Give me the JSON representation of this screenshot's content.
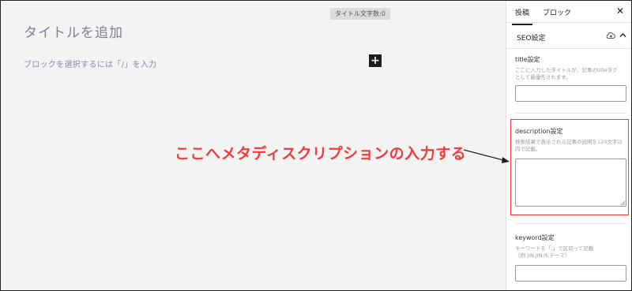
{
  "editor": {
    "title_count_badge": "タイトル文字数:0",
    "title_placeholder": "タイトルを追加",
    "block_prompt": "ブロックを選択するには「/」を入力",
    "add_block_symbol": "+"
  },
  "annotation": {
    "text": "ここへメタディスクリプションの入力する",
    "color": "#f23a3a"
  },
  "sidebar": {
    "tabs": [
      {
        "label": "投稿",
        "active": true
      },
      {
        "label": "ブロック",
        "active": false
      }
    ],
    "close_symbol": "✕",
    "panel": {
      "title": "SEO設定",
      "icons": [
        "cloud-icon",
        "chevron-up-icon"
      ]
    },
    "fields": [
      {
        "label": "title設定",
        "help": "ここに入力したタイトルが、記事のtitleタグとして最優先されます。",
        "value": ""
      },
      {
        "label": "description設定",
        "help": "検索結果で表示される記事の説明を120文字以内で記載。",
        "value": "",
        "highlighted": true
      },
      {
        "label": "keyword設定",
        "help": "キーワードを「,」で区切って記載（例:JIN,JIN:R,テーマ）",
        "value": ""
      }
    ]
  }
}
